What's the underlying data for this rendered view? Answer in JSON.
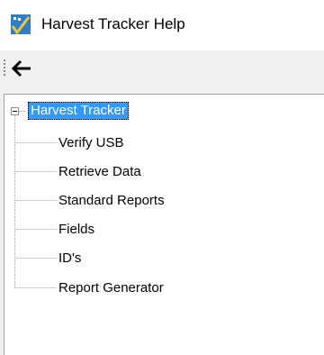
{
  "window": {
    "title": "Harvest Tracker Help",
    "icon": "harvest-tracker-app-icon"
  },
  "toolbar": {
    "back_icon": "arrow-left-icon"
  },
  "tree": {
    "root": {
      "label": "Harvest Tracker",
      "expanded": true,
      "selected": true
    },
    "children": [
      {
        "label": "Verify USB"
      },
      {
        "label": "Retrieve Data"
      },
      {
        "label": "Standard Reports"
      },
      {
        "label": "Fields"
      },
      {
        "label": "ID's"
      },
      {
        "label": "Report Generator"
      }
    ]
  },
  "colors": {
    "selection": "#3399ff",
    "background": "#f0f0f0",
    "panel": "#ffffff"
  }
}
